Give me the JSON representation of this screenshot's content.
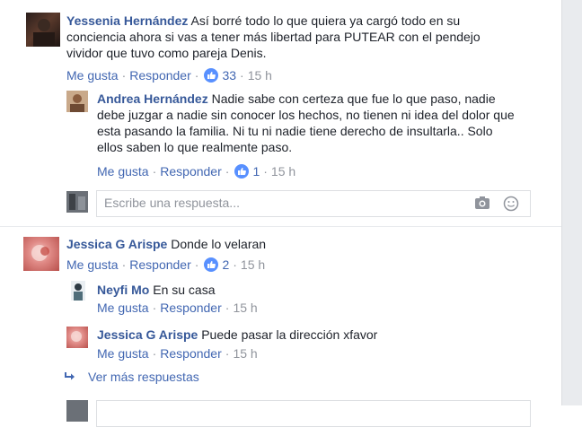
{
  "comments": [
    {
      "author": "Yessenia Hernández",
      "text": "Así borré todo lo que quiera ya cargó todo en su conciencia ahora si vas a tener más libertad para PUTEAR con el pendejo vividor que tuvo como pareja Denis.",
      "like_label": "Me gusta",
      "reply_label": "Responder",
      "likes": "33",
      "time": "15 h",
      "replies": [
        {
          "author": "Andrea Hernández",
          "text": "Nadie sabe con certeza que fue lo que paso, nadie debe juzgar a nadie sin conocer los hechos, no tienen ni idea del dolor que esta pasando la familia. Ni tu ni nadie tiene derecho de insultarla.. Solo ellos saben lo que realmente paso.",
          "like_label": "Me gusta",
          "reply_label": "Responder",
          "likes": "1",
          "time": "15 h"
        }
      ],
      "reply_placeholder": "Escribe una respuesta..."
    },
    {
      "author": "Jessica G Arispe",
      "text": "Donde lo velaran",
      "like_label": "Me gusta",
      "reply_label": "Responder",
      "likes": "2",
      "time": "15 h",
      "replies": [
        {
          "author": "Neyfi Mo",
          "text": "En su casa",
          "like_label": "Me gusta",
          "reply_label": "Responder",
          "time": "15 h"
        },
        {
          "author": "Jessica G Arispe",
          "text": "Puede pasar la dirección xfavor",
          "like_label": "Me gusta",
          "reply_label": "Responder",
          "time": "15 h"
        }
      ],
      "more_replies": "Ver más respuestas"
    }
  ],
  "icons": {
    "like": "thumbs-up-icon",
    "camera": "camera-icon",
    "emoji": "smiley-icon",
    "more_replies": "reply-arrow-icon"
  },
  "colors": {
    "link": "#365899",
    "action": "#4267b2",
    "meta": "#90949c",
    "like_badge": "#5890ff"
  }
}
